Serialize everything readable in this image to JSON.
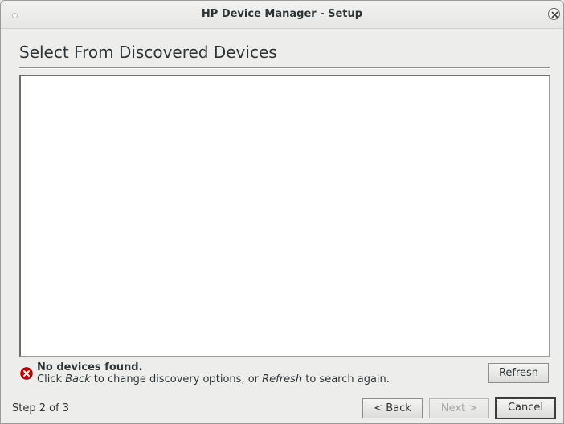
{
  "window": {
    "title": "HP Device Manager - Setup"
  },
  "page": {
    "heading": "Select From Discovered Devices"
  },
  "devices": [],
  "status": {
    "icon": "error-icon",
    "title": "No devices found.",
    "msg_prefix": "Click ",
    "msg_back": "Back",
    "msg_middle": " to change discovery options, or ",
    "msg_refresh": "Refresh",
    "msg_suffix": " to search again."
  },
  "buttons": {
    "refresh": "Refresh",
    "back": "< Back",
    "next": "Next >",
    "cancel": "Cancel"
  },
  "footer": {
    "step": "Step 2 of 3"
  },
  "colors": {
    "error": "#cc0000",
    "window_bg": "#ededec"
  }
}
